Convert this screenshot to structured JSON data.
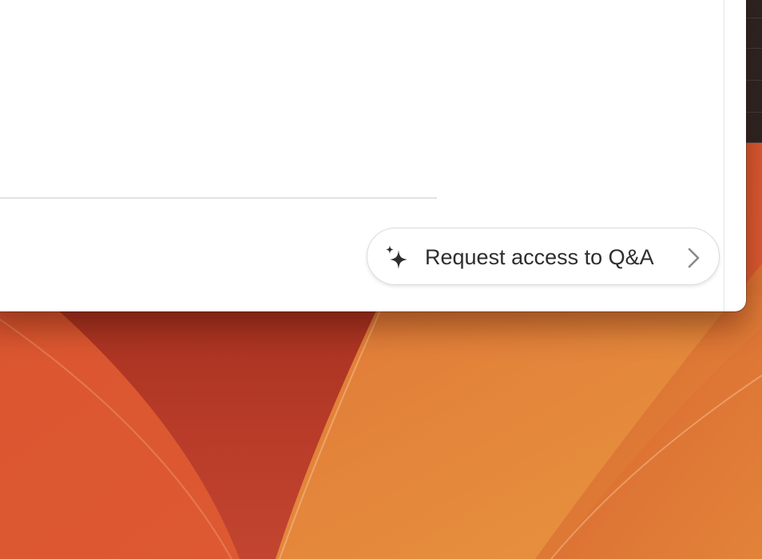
{
  "desktop": {
    "wallpaper_colors": [
      "#b6382a",
      "#d4542f",
      "#e07f3c",
      "#e8953e"
    ]
  },
  "qa_prompt": {
    "label": "Request access to Q&A",
    "leading_icon": "sparkle-icon",
    "trailing_icon": "chevron-right-icon"
  },
  "colors": {
    "window_background": "#ffffff",
    "pill_border": "#dcdcdc",
    "text": "#2e2e2e",
    "chevron": "#8a8a8a"
  }
}
